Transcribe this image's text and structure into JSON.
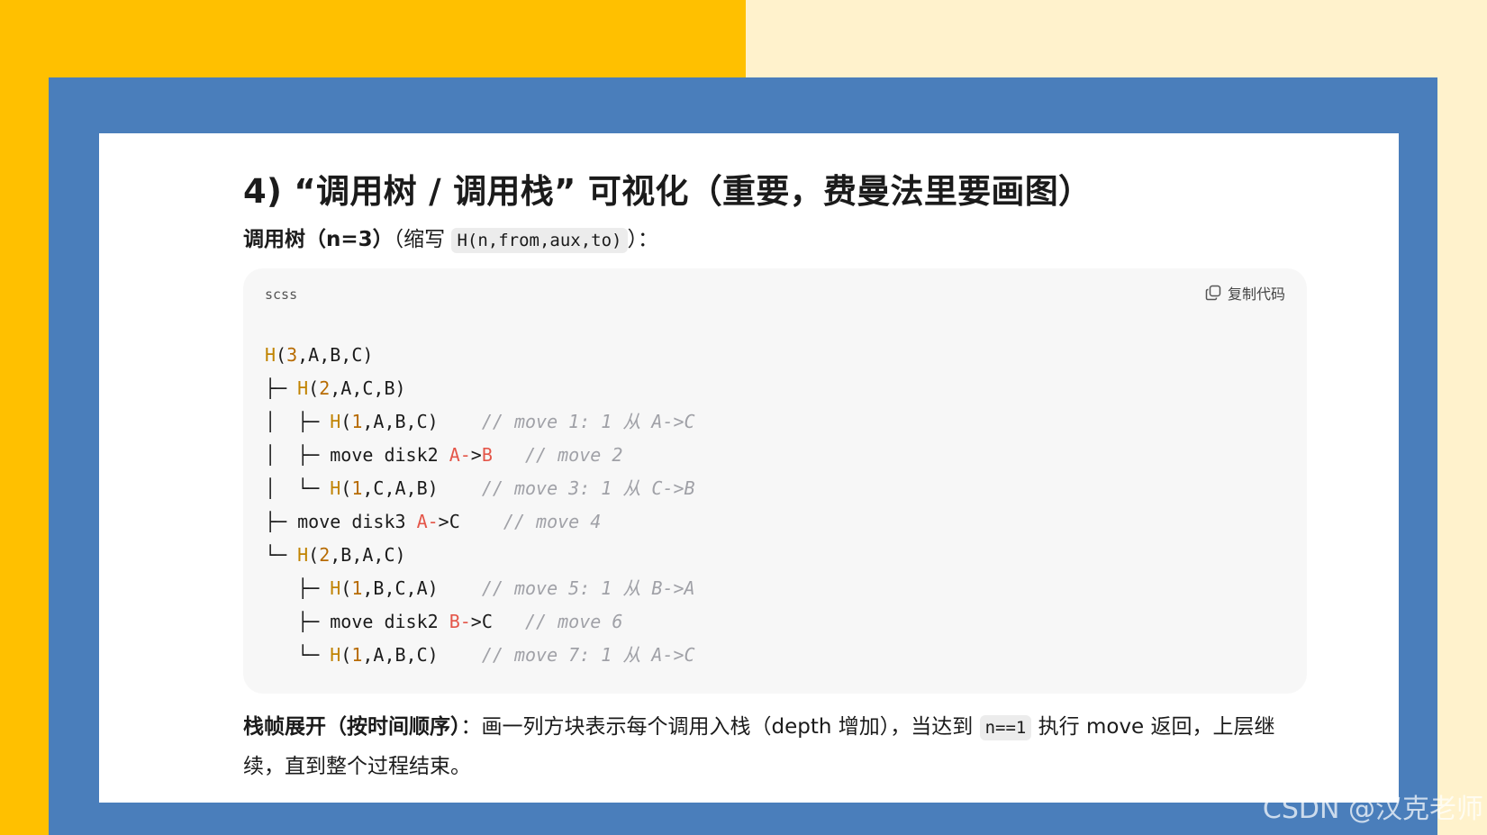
{
  "section": {
    "heading": "4) “调用树 / 调用栈” 可视化（重要，费曼法里要画图）",
    "subtitle_bold": "调用树（n=3）",
    "subtitle_prefix": "（缩写 ",
    "subtitle_code": "H(n,from,aux,to)",
    "subtitle_suffix": "）："
  },
  "code_block": {
    "language": "scss",
    "copy_label": "复制代码",
    "copy_icon": "copy-icon",
    "lines": [
      [
        {
          "t": "H",
          "c": "fn"
        },
        {
          "t": "(",
          "c": "plain"
        },
        {
          "t": "3",
          "c": "num"
        },
        {
          "t": ",A,B,C)",
          "c": "plain"
        }
      ],
      [
        {
          "t": "├─ ",
          "c": "plain"
        },
        {
          "t": "H",
          "c": "fn"
        },
        {
          "t": "(",
          "c": "plain"
        },
        {
          "t": "2",
          "c": "num"
        },
        {
          "t": ",A,C,B)",
          "c": "plain"
        }
      ],
      [
        {
          "t": "│  ├─ ",
          "c": "plain"
        },
        {
          "t": "H",
          "c": "fn"
        },
        {
          "t": "(",
          "c": "plain"
        },
        {
          "t": "1",
          "c": "num"
        },
        {
          "t": ",A,B,C)    ",
          "c": "plain"
        },
        {
          "t": "// move 1: 1 从 A->C",
          "c": "comment"
        }
      ],
      [
        {
          "t": "│  ├─ move disk2 ",
          "c": "plain"
        },
        {
          "t": "A-",
          "c": "red"
        },
        {
          "t": ">",
          "c": "plain"
        },
        {
          "t": "B",
          "c": "red"
        },
        {
          "t": "   ",
          "c": "plain"
        },
        {
          "t": "// move 2",
          "c": "comment"
        }
      ],
      [
        {
          "t": "│  └─ ",
          "c": "plain"
        },
        {
          "t": "H",
          "c": "fn"
        },
        {
          "t": "(",
          "c": "plain"
        },
        {
          "t": "1",
          "c": "num"
        },
        {
          "t": ",C,A,B)    ",
          "c": "plain"
        },
        {
          "t": "// move 3: 1 从 C->B",
          "c": "comment"
        }
      ],
      [
        {
          "t": "├─ move disk3 ",
          "c": "plain"
        },
        {
          "t": "A-",
          "c": "red"
        },
        {
          "t": ">C    ",
          "c": "plain"
        },
        {
          "t": "// move 4",
          "c": "comment"
        }
      ],
      [
        {
          "t": "└─ ",
          "c": "plain"
        },
        {
          "t": "H",
          "c": "fn"
        },
        {
          "t": "(",
          "c": "plain"
        },
        {
          "t": "2",
          "c": "num"
        },
        {
          "t": ",B,A,C)",
          "c": "plain"
        }
      ],
      [
        {
          "t": "   ├─ ",
          "c": "plain"
        },
        {
          "t": "H",
          "c": "fn"
        },
        {
          "t": "(",
          "c": "plain"
        },
        {
          "t": "1",
          "c": "num"
        },
        {
          "t": ",B,C,A)    ",
          "c": "plain"
        },
        {
          "t": "// move 5: 1 从 B->A",
          "c": "comment"
        }
      ],
      [
        {
          "t": "   ├─ move disk2 ",
          "c": "plain"
        },
        {
          "t": "B-",
          "c": "red"
        },
        {
          "t": ">C   ",
          "c": "plain"
        },
        {
          "t": "// move 6",
          "c": "comment"
        }
      ],
      [
        {
          "t": "   └─ ",
          "c": "plain"
        },
        {
          "t": "H",
          "c": "fn"
        },
        {
          "t": "(",
          "c": "plain"
        },
        {
          "t": "1",
          "c": "num"
        },
        {
          "t": ",A,B,C)    ",
          "c": "plain"
        },
        {
          "t": "// move 7: 1 从 A->C",
          "c": "comment"
        }
      ]
    ]
  },
  "paragraph": {
    "bold": "栈帧展开（按时间顺序）",
    "text_before_code": "：画一列方块表示每个调用入栈（depth 增加），当达到 ",
    "code": "n==1",
    "text_after_code": " 执行 move 返回，上层继续，直到整个过程结束。"
  },
  "watermark": "CSDN @汉克老师",
  "colors": {
    "left_bg": "#ffc000",
    "right_bg": "#fff2cc",
    "frame": "#4a7ebb",
    "code_bg": "#f7f7f7",
    "fn": "#c18401",
    "red": "#e45649",
    "comment": "#a0a1a7"
  }
}
